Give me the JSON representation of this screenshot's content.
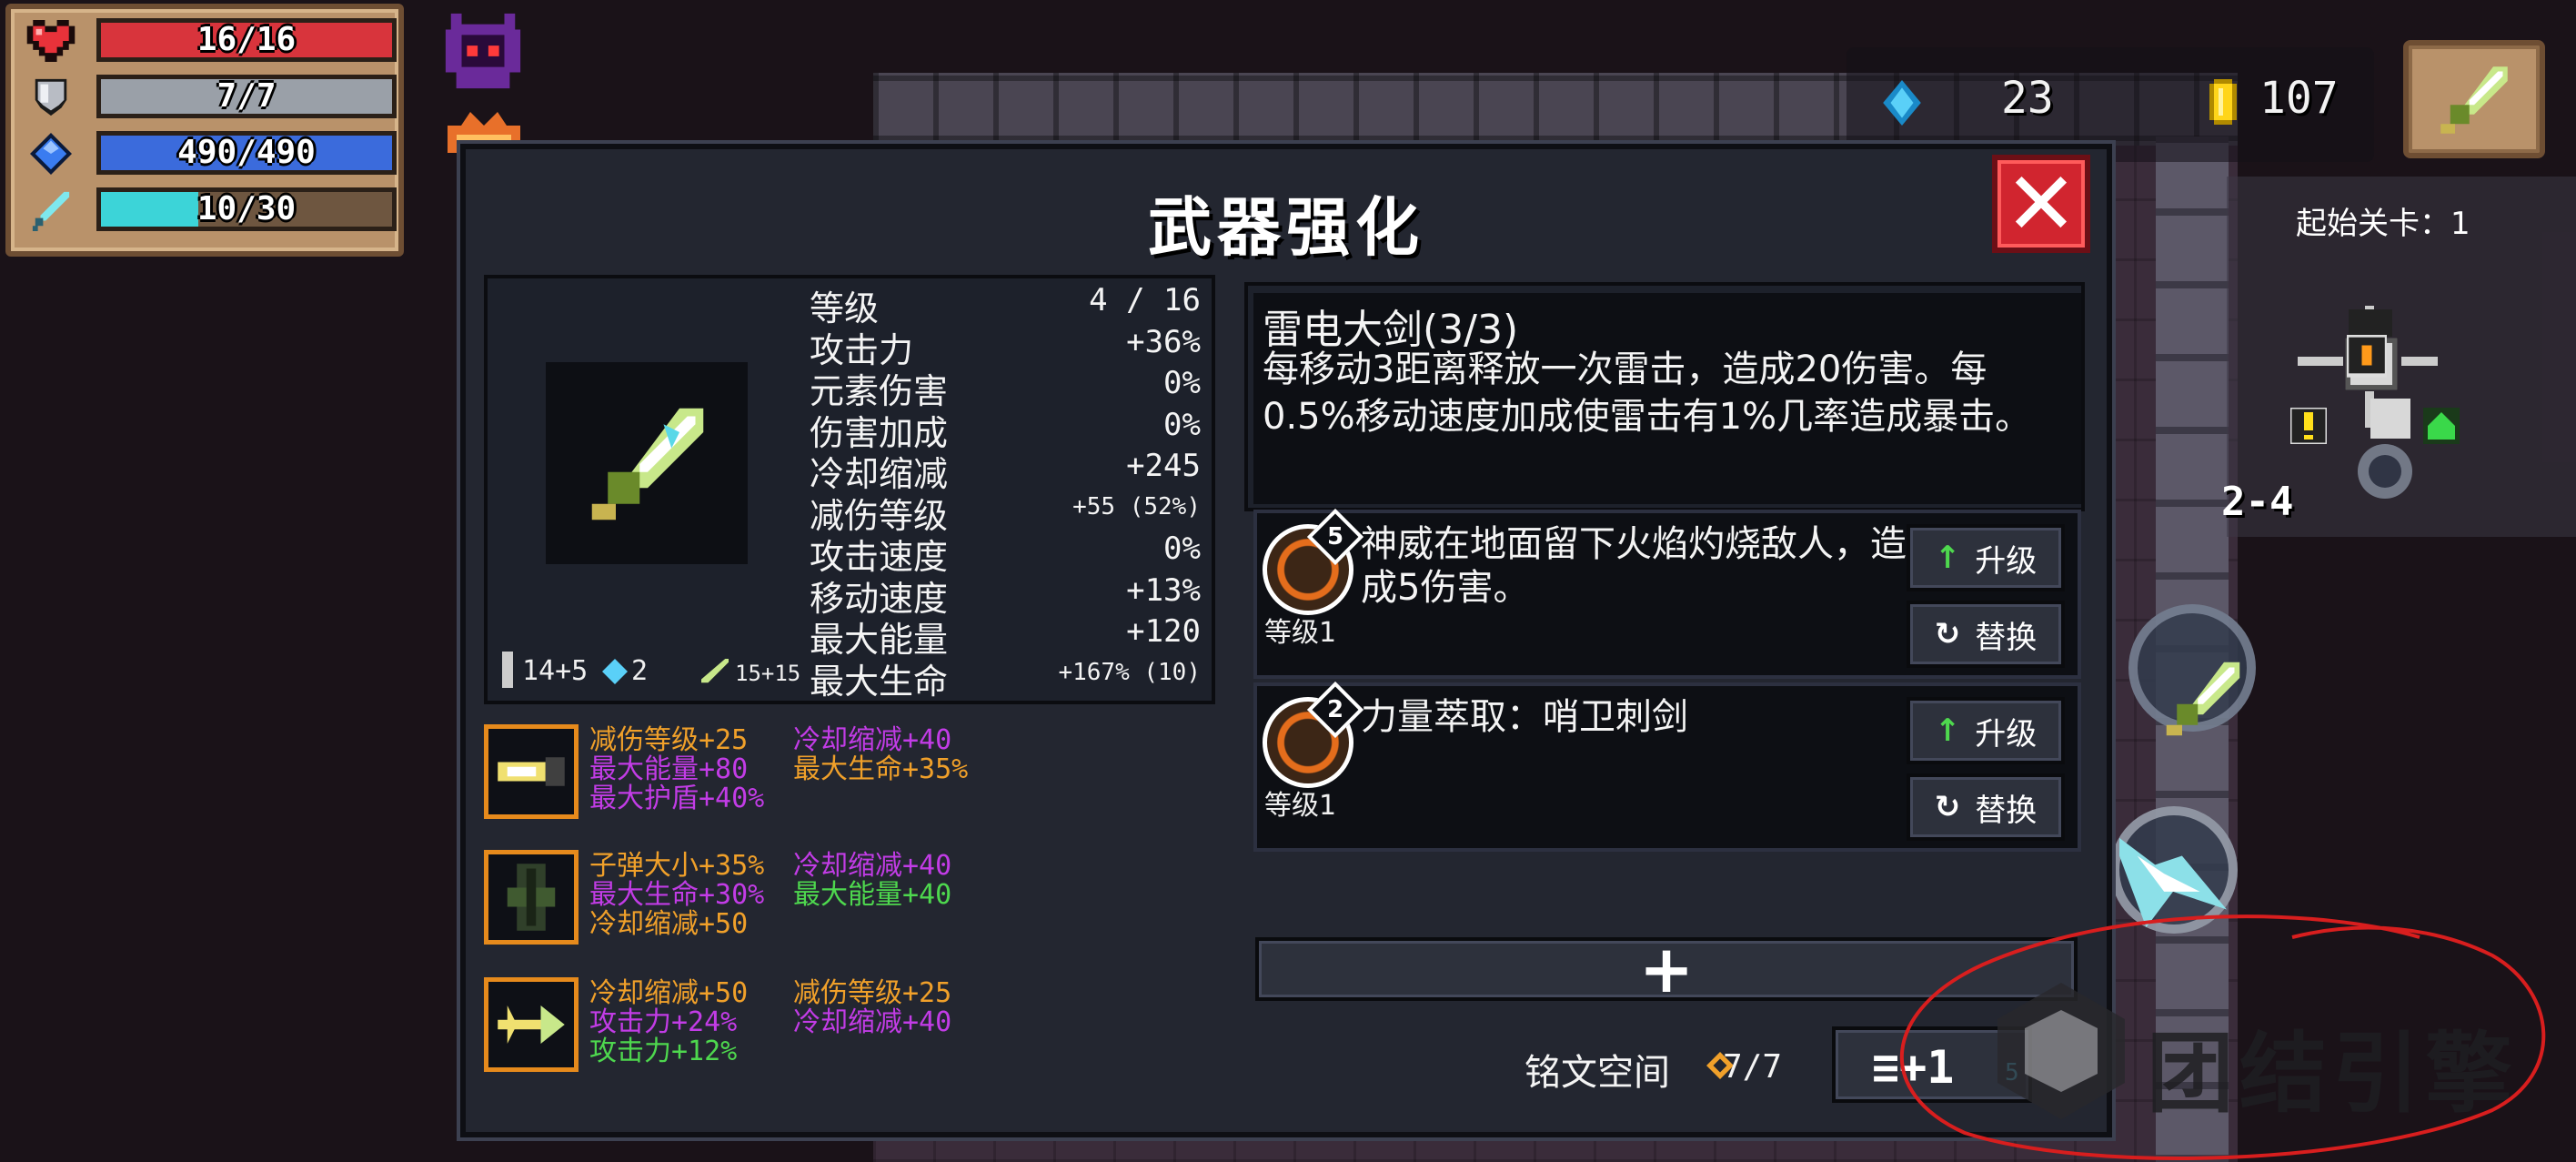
{
  "player_stats": {
    "health": "16/16",
    "armor": "7/7",
    "energy": "490/490",
    "weapon_charge": "10/30",
    "health_fill": 1.0,
    "armor_fill": 1.0,
    "energy_fill": 1.0,
    "charge_fill": 0.333
  },
  "currency": {
    "gems": "23",
    "coins": "107"
  },
  "minimap": {
    "title": "起始关卡：1",
    "level": "2-4"
  },
  "modal": {
    "title": "武器强化",
    "close_icon": "close-icon"
  },
  "weapon_stats": [
    {
      "label": "等级",
      "value": "4 / 16"
    },
    {
      "label": "攻击力",
      "value": "+36%"
    },
    {
      "label": "元素伤害",
      "value": "0%"
    },
    {
      "label": "伤害加成",
      "value": "0%"
    },
    {
      "label": "冷却缩减",
      "value": "+245"
    },
    {
      "label": "减伤等级",
      "value": "+55 (52%)"
    },
    {
      "label": "攻击速度",
      "value": "0%"
    },
    {
      "label": "移动速度",
      "value": "+13%"
    },
    {
      "label": "最大能量",
      "value": "+120"
    },
    {
      "label": "最大生命",
      "value": "+167% (10)"
    }
  ],
  "weapon_meta": {
    "damage": "14+5",
    "energy_cost": "2",
    "crit": "15+15"
  },
  "runes": [
    {
      "lines": [
        [
          {
            "text": "减伤等级+25",
            "color": "orange"
          },
          {
            "text": "冷却缩减+40",
            "color": "purple"
          }
        ],
        [
          {
            "text": "最大能量+80",
            "color": "purple"
          },
          {
            "text": "最大生命+35%",
            "color": "orange"
          }
        ],
        [
          {
            "text": "最大护盾+40%",
            "color": "purple"
          }
        ]
      ]
    },
    {
      "lines": [
        [
          {
            "text": "子弹大小+35%",
            "color": "orange"
          },
          {
            "text": "冷却缩减+40",
            "color": "purple"
          }
        ],
        [
          {
            "text": "最大生命+30%",
            "color": "purple"
          },
          {
            "text": "最大能量+40",
            "color": "green"
          }
        ],
        [
          {
            "text": "冷却缩减+50",
            "color": "orange"
          }
        ]
      ]
    },
    {
      "lines": [
        [
          {
            "text": "冷却缩减+50",
            "color": "orange"
          },
          {
            "text": "减伤等级+25",
            "color": "orange"
          }
        ],
        [
          {
            "text": "攻击力+24%",
            "color": "purple"
          },
          {
            "text": "冷却缩减+40",
            "color": "purple"
          }
        ],
        [
          {
            "text": "攻击力+12%",
            "color": "green"
          }
        ]
      ]
    }
  ],
  "description": {
    "title": "雷电大剑(3/3)",
    "body": "每移动3距离释放一次雷击，造成20伤害。每0.5%移动速度加成使雷击有1%几率造成暴击。"
  },
  "skills": [
    {
      "badge": "5",
      "level": "等级1",
      "desc": "神威在地面留下火焰灼烧敌人，造成5伤害。",
      "upgrade": "升级",
      "replace": "替换"
    },
    {
      "badge": "2",
      "level": "等级1",
      "desc": "力量萃取：哨卫刺剑",
      "upgrade": "升级",
      "replace": "替换"
    }
  ],
  "footer": {
    "plus": "+",
    "rune_space_label": "铭文空间",
    "rune_space_value": "7/7",
    "rune_button": "≡+1",
    "rune_button_count": "5"
  },
  "watermark": "团结引擎",
  "colors": {
    "orange": "#f0a02a",
    "purple": "#c23ce6",
    "green": "#4ed84e"
  }
}
